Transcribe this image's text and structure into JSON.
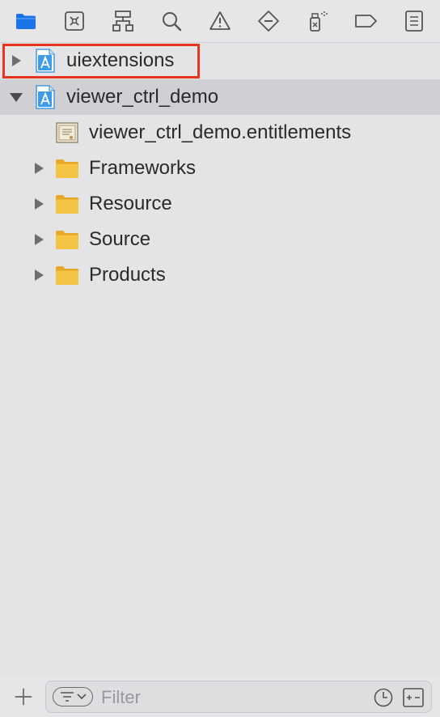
{
  "navigator_tabs": [
    {
      "name": "project-navigator",
      "icon": "folder-icon",
      "active": true
    },
    {
      "name": "source-control-navigator",
      "icon": "source-control-icon",
      "active": false
    },
    {
      "name": "symbol-navigator",
      "icon": "hierarchy-icon",
      "active": false
    },
    {
      "name": "find-navigator",
      "icon": "magnifier-icon",
      "active": false
    },
    {
      "name": "issue-navigator",
      "icon": "warning-icon",
      "active": false
    },
    {
      "name": "test-navigator",
      "icon": "diamond-minus-icon",
      "active": false
    },
    {
      "name": "debug-navigator",
      "icon": "spray-icon",
      "active": false
    },
    {
      "name": "breakpoint-navigator",
      "icon": "tag-icon",
      "active": false
    },
    {
      "name": "report-navigator",
      "icon": "list-icon",
      "active": false
    }
  ],
  "tree": {
    "items": [
      {
        "label": "uiextensions",
        "icon": "xcode-project-icon",
        "disclosure": "collapsed",
        "level": 0,
        "selected": false,
        "highlighted": true
      },
      {
        "label": "viewer_ctrl_demo",
        "icon": "xcode-project-icon",
        "disclosure": "expanded",
        "level": 0,
        "selected": true
      },
      {
        "label": "viewer_ctrl_demo.entitlements",
        "icon": "entitlements-file-icon",
        "disclosure": "none",
        "level": 1
      },
      {
        "label": "Frameworks",
        "icon": "folder-icon",
        "disclosure": "collapsed",
        "level": 1
      },
      {
        "label": "Resource",
        "icon": "folder-icon",
        "disclosure": "collapsed",
        "level": 1
      },
      {
        "label": "Source",
        "icon": "folder-icon",
        "disclosure": "collapsed",
        "level": 1
      },
      {
        "label": "Products",
        "icon": "folder-icon",
        "disclosure": "collapsed",
        "level": 1
      }
    ]
  },
  "bottom": {
    "add_icon": "plus-icon",
    "filter_placeholder": "Filter",
    "filter_value": ""
  },
  "colors": {
    "accent": "#1a73e8",
    "highlight_border": "#e8341c",
    "folder": "#f6c443",
    "selection": "#d0d0d4"
  }
}
